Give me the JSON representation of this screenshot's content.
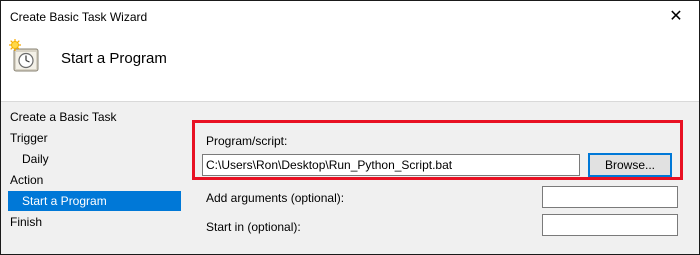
{
  "window": {
    "title": "Create Basic Task Wizard",
    "close_glyph": "✕"
  },
  "header": {
    "icon": "task-scheduler-clock-icon",
    "title": "Start a Program"
  },
  "nav": {
    "items": [
      {
        "label": "Create a Basic Task"
      },
      {
        "label": "Trigger"
      },
      {
        "label": "Daily"
      },
      {
        "label": "Action"
      },
      {
        "label": "Start a Program"
      },
      {
        "label": "Finish"
      }
    ]
  },
  "form": {
    "program_label": "Program/script:",
    "program_value": "C:\\Users\\Ron\\Desktop\\Run_Python_Script.bat",
    "browse_label": "Browse...",
    "arguments_label": "Add arguments (optional):",
    "arguments_value": "",
    "start_in_label": "Start in (optional):",
    "start_in_value": ""
  },
  "colors": {
    "highlight": "#e81123",
    "selection": "#0078d7"
  }
}
